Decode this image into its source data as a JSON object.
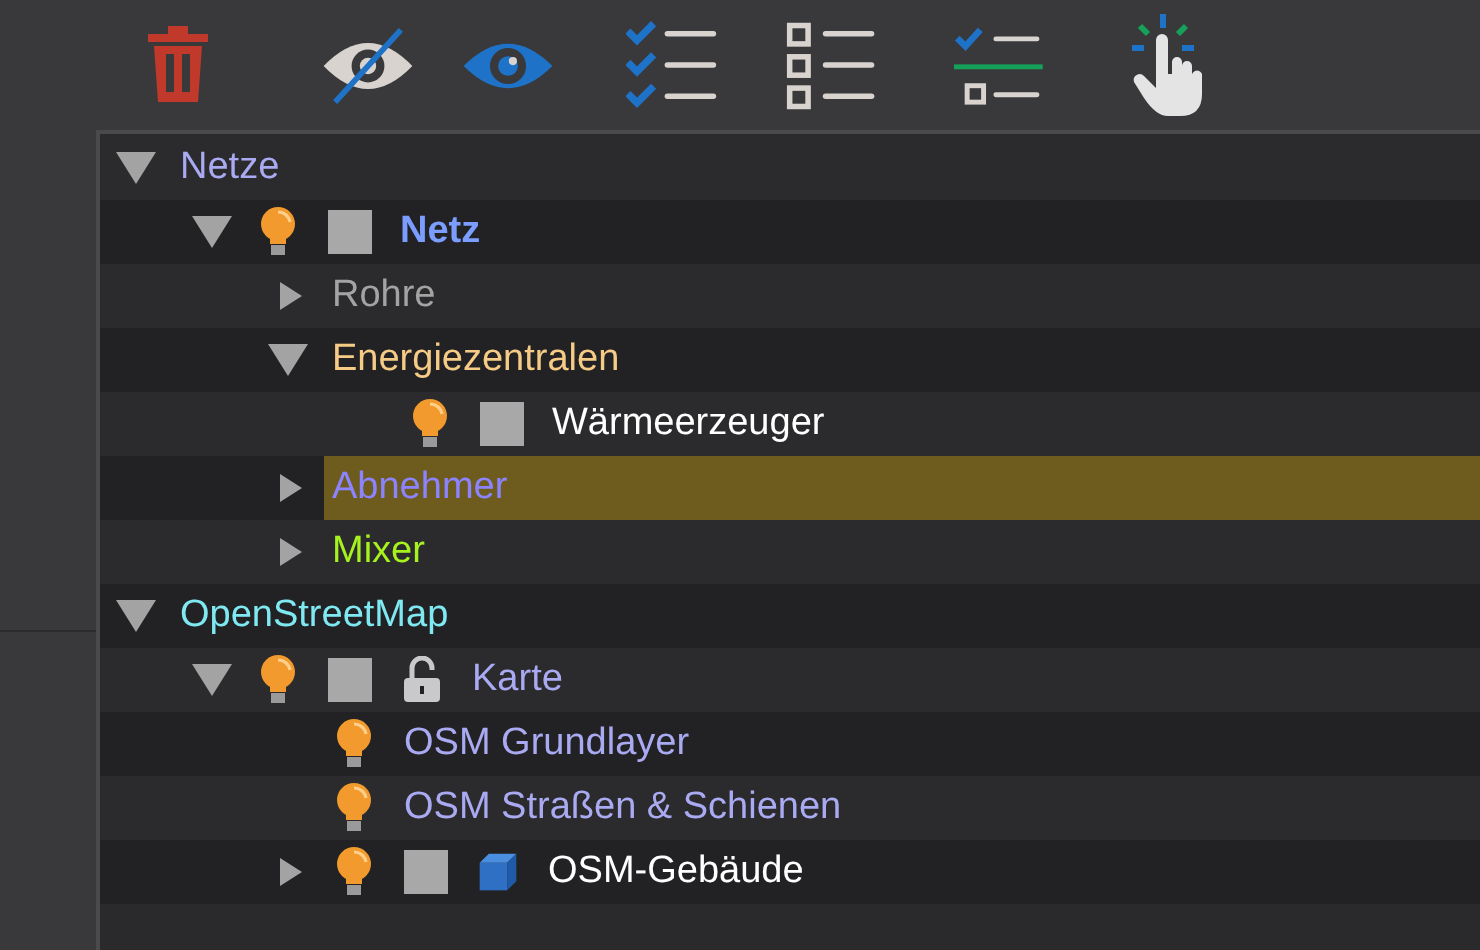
{
  "tree": [
    {
      "label": "Netze",
      "color": "#a9aaf2",
      "bold": false,
      "selected": false,
      "expanded": true,
      "children": [
        {
          "label": "Netz",
          "color": "#7b9dff",
          "bold": true,
          "selected": false,
          "expanded": true,
          "visible": true,
          "checked": false,
          "children": [
            {
              "label": "Rohre",
              "color": "#a3a3a3",
              "bold": false,
              "selected": false,
              "expanded": false
            },
            {
              "label": "Energiezentralen",
              "color": "#f6cb86",
              "bold": false,
              "selected": false,
              "expanded": true,
              "children": [
                {
                  "label": "Wärmeerzeuger",
                  "color": "#ffffff",
                  "bold": false,
                  "selected": false,
                  "visible": true,
                  "checked": false
                }
              ]
            },
            {
              "label": "Abnehmer",
              "color": "#8c84ff",
              "bold": false,
              "selected": true,
              "expanded": false
            },
            {
              "label": "Mixer",
              "color": "#a6f21e",
              "bold": false,
              "selected": false,
              "expanded": false
            }
          ]
        }
      ]
    },
    {
      "label": "OpenStreetMap",
      "color": "#7fe9f2",
      "bold": false,
      "selected": false,
      "expanded": true,
      "children": [
        {
          "label": "Karte",
          "color": "#a9aaf2",
          "bold": false,
          "selected": false,
          "expanded": true,
          "visible": true,
          "checked": false,
          "locked": false,
          "children": [
            {
              "label": "OSM Grundlayer",
              "color": "#a9aaf2",
              "bold": false,
              "selected": false,
              "visible": true
            },
            {
              "label": "OSM Straßen & Schienen",
              "color": "#a9aaf2",
              "bold": false,
              "selected": false,
              "visible": true
            },
            {
              "label": "OSM-Gebäude",
              "kind": "model",
              "color": "#ffffff",
              "bold": false,
              "selected": false,
              "expanded": false,
              "visible": true,
              "checked": false
            }
          ]
        }
      ]
    }
  ]
}
